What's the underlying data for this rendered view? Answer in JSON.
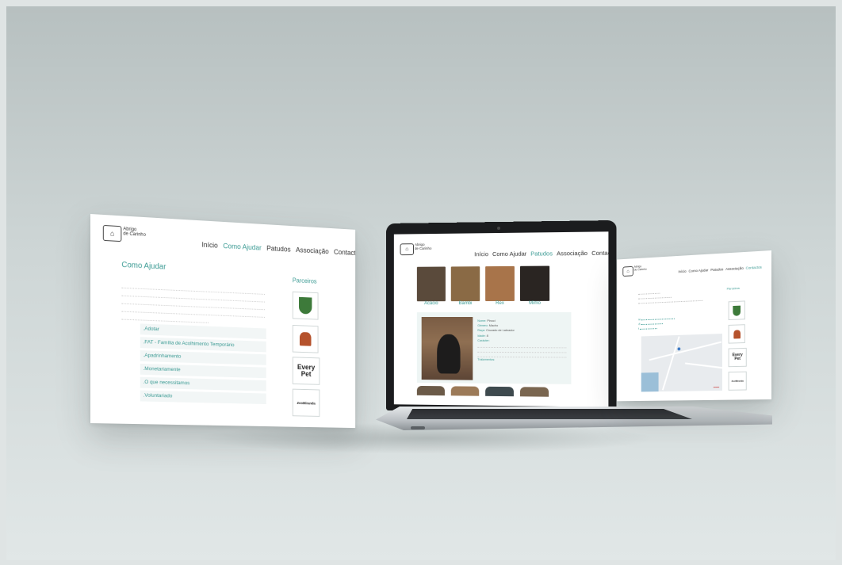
{
  "pages": {
    "left": {
      "brand": {
        "name_line1": "Abrigo",
        "name_line2": "de Carinho"
      },
      "nav": [
        "Início",
        "Como Ajudar",
        "Patudos",
        "Associação",
        "Contactos"
      ],
      "active_nav": "Como Ajudar",
      "section_title": "Como Ajudar",
      "help_items": [
        ".Adotar",
        ".FAT - Família de Acolhimento Temporário",
        ".Apadrinhamento",
        ".Monetariamente",
        ".O que necessitamos",
        ".Voluntariado"
      ],
      "partners_title": "Parceiros",
      "partners": [
        "Every Pet",
        "ZooMiranda"
      ]
    },
    "laptop": {
      "brand": {
        "name_line1": "Abrigo",
        "name_line2": "de Carinho"
      },
      "nav": [
        "Início",
        "Como Ajudar",
        "Patudos",
        "Associação",
        "Contactos"
      ],
      "active_nav": "Patudos",
      "dogs": [
        {
          "name": "Acácio",
          "color": "#5a4a3b"
        },
        {
          "name": "Bambi",
          "color": "#8a6a45"
        },
        {
          "name": "Rex",
          "color": "#a8744a"
        },
        {
          "name": "Mimo",
          "color": "#2a2522"
        }
      ],
      "detail": {
        "nome_label": "Nome:",
        "nome": "Pinoci",
        "genero_label": "Género:",
        "genero": "Macho",
        "raca_label": "Raça:",
        "raca": "Cruzado de Labrador",
        "idade_label": "Idade:",
        "idade": "8",
        "caracter_label": "Carácter:",
        "tratamentos_label": "Tratamentos:"
      },
      "more_dog_colors": [
        "#6b5a48",
        "#9c7a58",
        "#3e4a4e",
        "#7a6650"
      ]
    },
    "right": {
      "brand": {
        "name_line1": "Abrigo",
        "name_line2": "de Carinho"
      },
      "nav": [
        "Início",
        "Como Ajudar",
        "Patudos",
        "Associação",
        "Contactos"
      ],
      "active_nav": "Contactos",
      "partners_title": "Parceiros",
      "partners": [
        "Every Pet",
        "ZooMiranda"
      ]
    }
  }
}
